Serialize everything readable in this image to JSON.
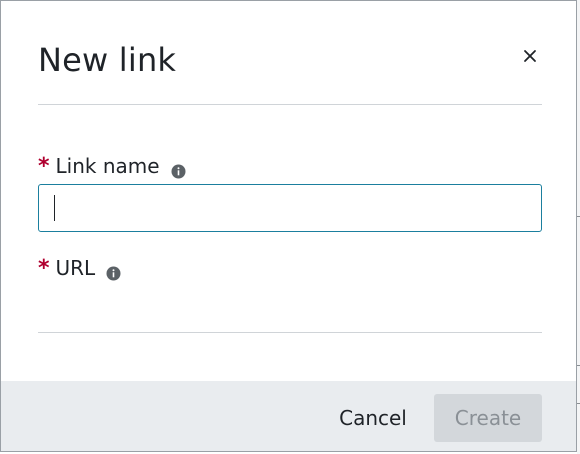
{
  "dialog": {
    "title": "New link",
    "close_icon": "close-icon"
  },
  "fields": {
    "link_name": {
      "required_marker": "*",
      "label": "Link name",
      "info_icon": "info-icon",
      "value": "",
      "placeholder": ""
    },
    "url": {
      "required_marker": "*",
      "label": "URL",
      "info_icon": "info-icon"
    }
  },
  "footer": {
    "cancel_label": "Cancel",
    "create_label": "Create"
  },
  "colors": {
    "required": "#b0002f",
    "input_focus_border": "#1b7f9e",
    "footer_bg": "#e9ecef",
    "disabled_button_bg": "#d3d7db",
    "disabled_button_text": "#8a9096"
  }
}
